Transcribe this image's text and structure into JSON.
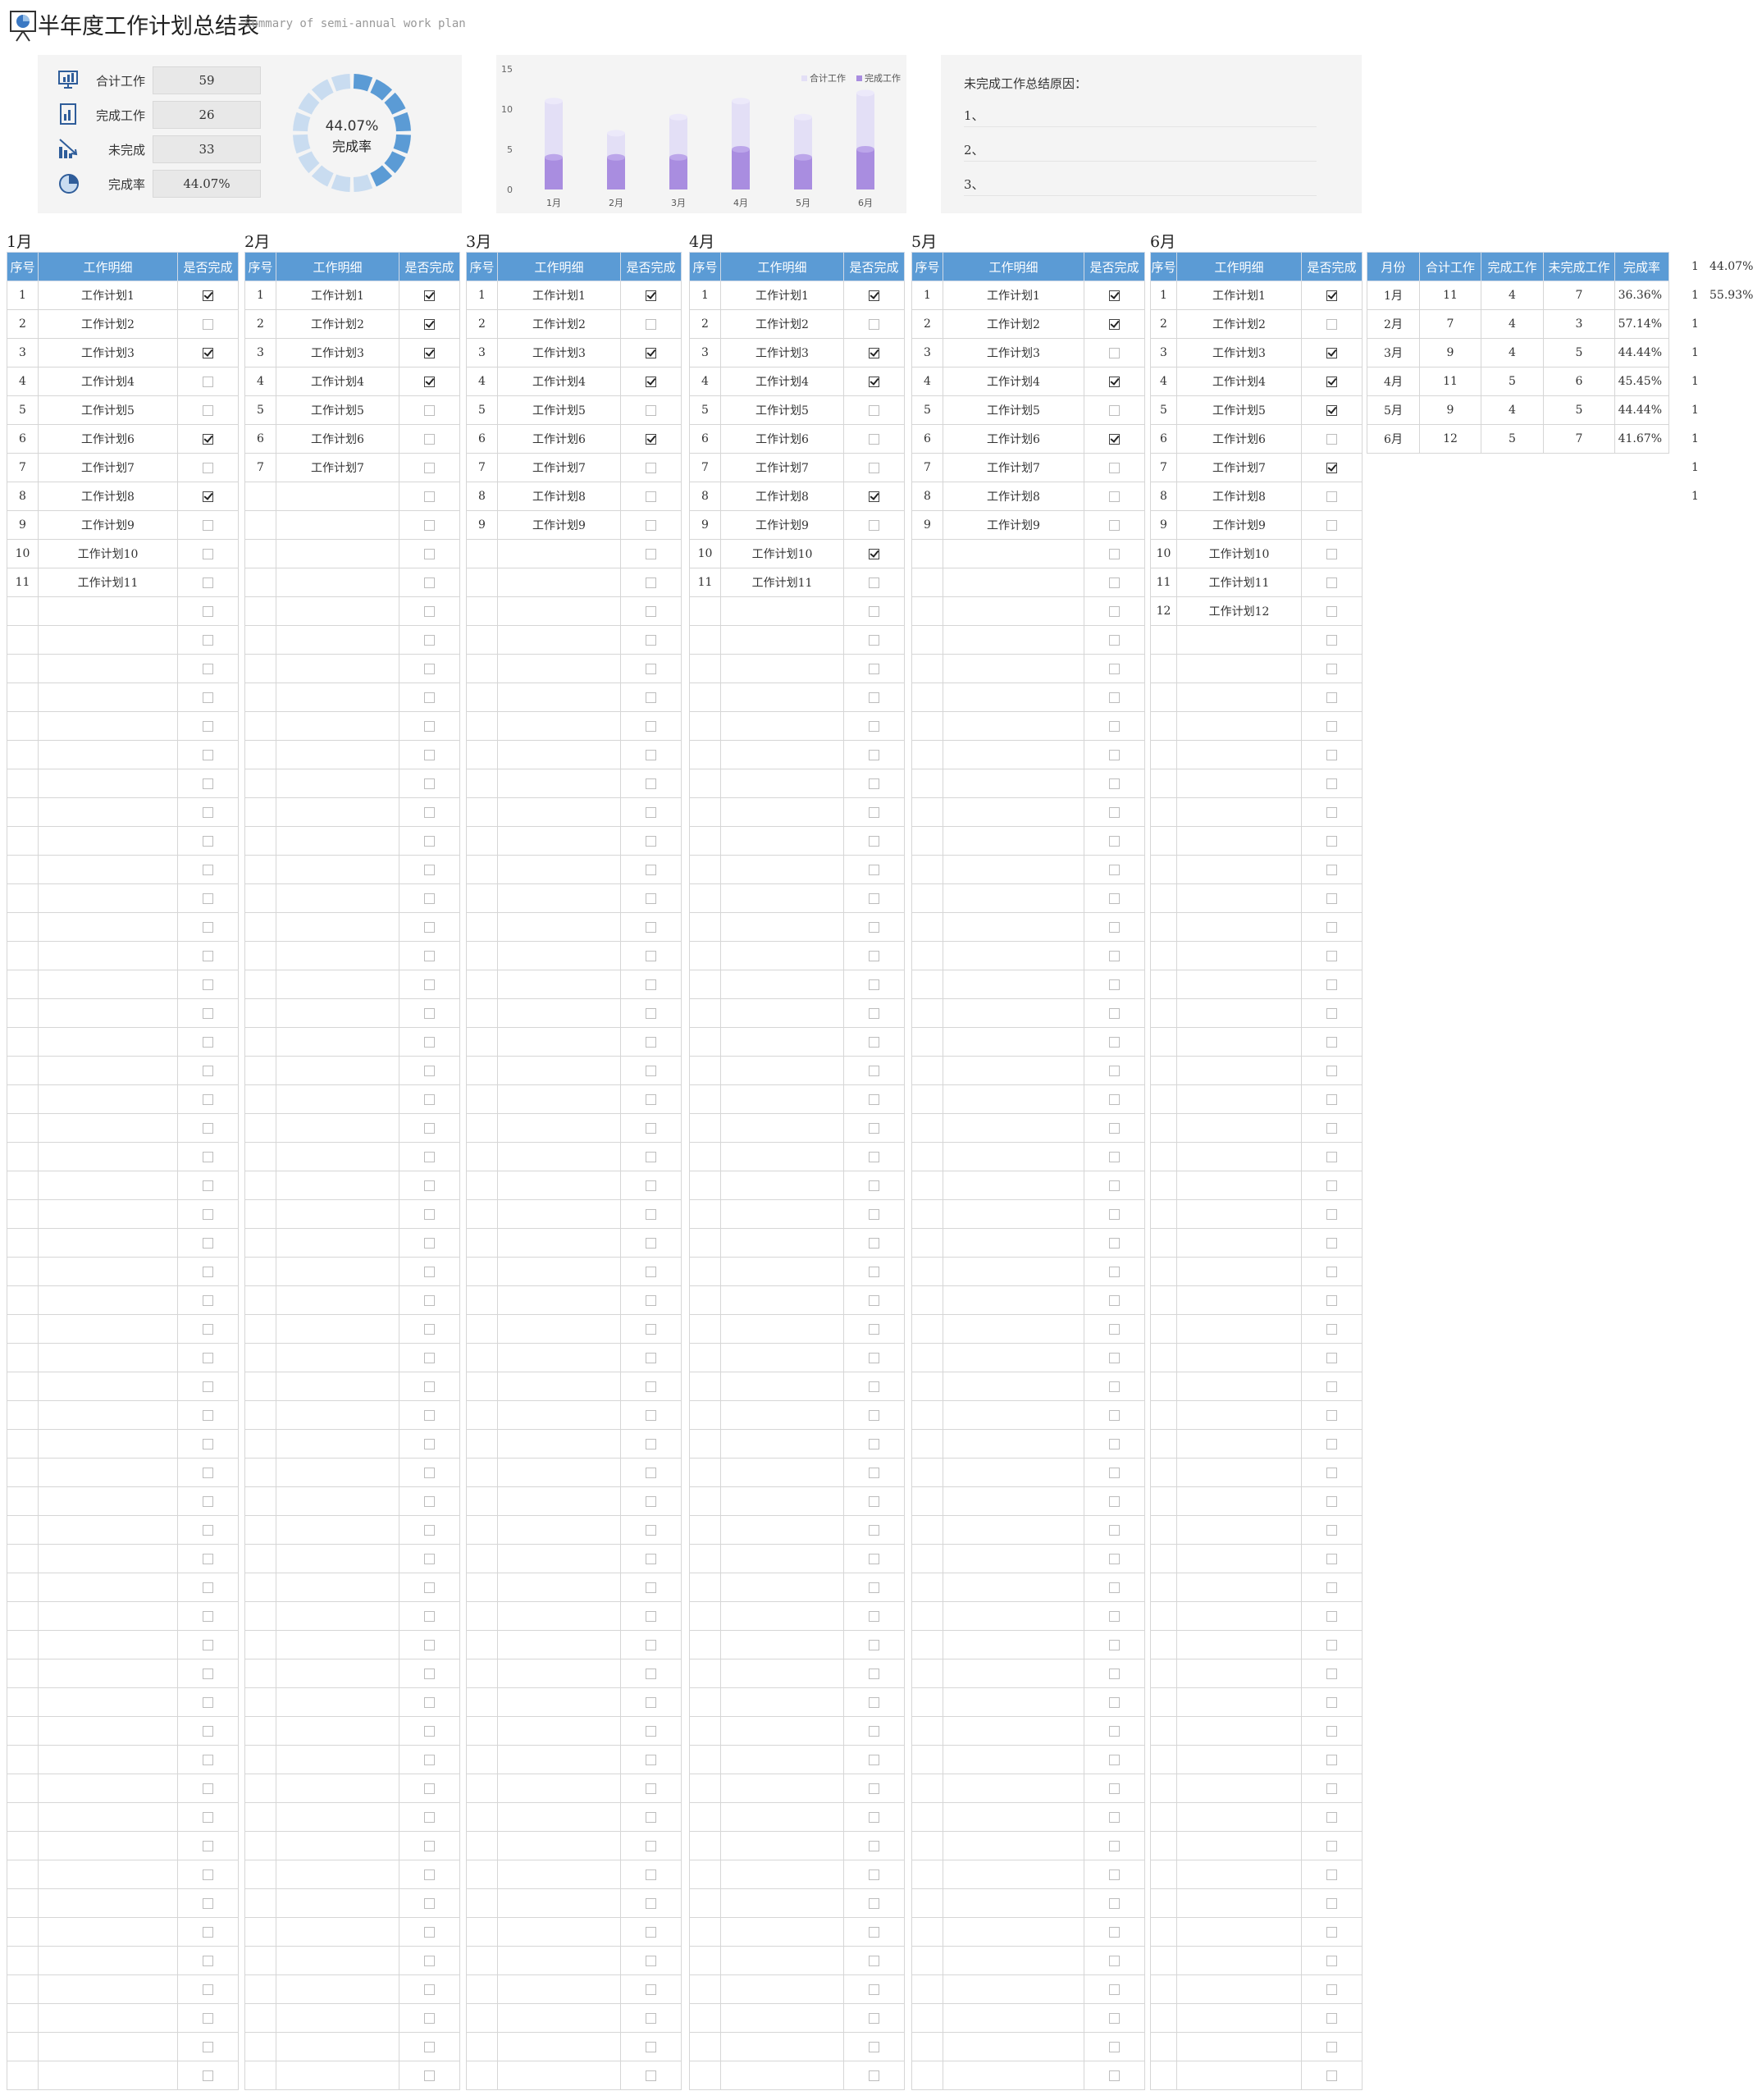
{
  "header": {
    "title": "半年度工作计划总结表",
    "subtitle": "Summary of semi-annual work plan"
  },
  "kpi": {
    "items": [
      {
        "label": "合计工作",
        "value": "59",
        "icon": "monitor-chart-icon"
      },
      {
        "label": "完成工作",
        "value": "26",
        "icon": "document-chart-icon"
      },
      {
        "label": "未完成",
        "value": "33",
        "icon": "trend-down-chart-icon"
      },
      {
        "label": "完成率",
        "value": "44.07%",
        "icon": "pie-chart-icon"
      }
    ],
    "donut": {
      "percent_text": "44.07%",
      "label": "完成率",
      "fraction": 0.4407,
      "color_done": "#5b9bd5",
      "color_rest": "#c9dcf0"
    }
  },
  "chart_data": {
    "type": "bar",
    "categories": [
      "1月",
      "2月",
      "3月",
      "4月",
      "5月",
      "6月"
    ],
    "series": [
      {
        "name": "合计工作",
        "values": [
          11,
          7,
          9,
          11,
          9,
          12
        ],
        "color": "#e3dff6"
      },
      {
        "name": "完成工作",
        "values": [
          4,
          4,
          4,
          5,
          4,
          5
        ],
        "color": "#a98de0"
      }
    ],
    "ylim": [
      0,
      15
    ],
    "yticks": [
      "0",
      "5",
      "10",
      "15"
    ],
    "legend": "top-right",
    "legend_labels": [
      "合计工作",
      "完成工作"
    ]
  },
  "notes": {
    "title": "未完成工作总结原因：",
    "lines": [
      "1、",
      "2、",
      "3、"
    ]
  },
  "table_headers": {
    "no": "序号",
    "detail": "工作明细",
    "done": "是否完成"
  },
  "months": [
    {
      "label": "1月",
      "items": [
        "工作计划1",
        "工作计划2",
        "工作计划3",
        "工作计划4",
        "工作计划5",
        "工作计划6",
        "工作计划7",
        "工作计划8",
        "工作计划9",
        "工作计划10",
        "工作计划11"
      ],
      "done": [
        1,
        0,
        1,
        0,
        0,
        1,
        0,
        1,
        0,
        0,
        0
      ]
    },
    {
      "label": "2月",
      "items": [
        "工作计划1",
        "工作计划2",
        "工作计划3",
        "工作计划4",
        "工作计划5",
        "工作计划6",
        "工作计划7"
      ],
      "done": [
        1,
        1,
        1,
        1,
        0,
        0,
        0
      ]
    },
    {
      "label": "3月",
      "items": [
        "工作计划1",
        "工作计划2",
        "工作计划3",
        "工作计划4",
        "工作计划5",
        "工作计划6",
        "工作计划7",
        "工作计划8",
        "工作计划9"
      ],
      "done": [
        1,
        0,
        1,
        1,
        0,
        1,
        0,
        0,
        0
      ]
    },
    {
      "label": "4月",
      "items": [
        "工作计划1",
        "工作计划2",
        "工作计划3",
        "工作计划4",
        "工作计划5",
        "工作计划6",
        "工作计划7",
        "工作计划8",
        "工作计划9",
        "工作计划10",
        "工作计划11"
      ],
      "done": [
        1,
        0,
        1,
        1,
        0,
        0,
        0,
        1,
        0,
        1,
        0
      ]
    },
    {
      "label": "5月",
      "items": [
        "工作计划1",
        "工作计划2",
        "工作计划3",
        "工作计划4",
        "工作计划5",
        "工作计划6",
        "工作计划7",
        "工作计划8",
        "工作计划9"
      ],
      "done": [
        1,
        1,
        0,
        1,
        0,
        1,
        0,
        0,
        0
      ]
    },
    {
      "label": "6月",
      "items": [
        "工作计划1",
        "工作计划2",
        "工作计划3",
        "工作计划4",
        "工作计划5",
        "工作计划6",
        "工作计划7",
        "工作计划8",
        "工作计划9",
        "工作计划10",
        "工作计划11",
        "工作计划12"
      ],
      "done": [
        1,
        0,
        1,
        1,
        1,
        0,
        1,
        0,
        0,
        0,
        0,
        0
      ]
    }
  ],
  "summary": {
    "headers": [
      "月份",
      "合计工作",
      "完成工作",
      "未完成工作",
      "完成率"
    ],
    "rows": [
      [
        "1月",
        "11",
        "4",
        "7",
        "36.36%"
      ],
      [
        "2月",
        "7",
        "4",
        "3",
        "57.14%"
      ],
      [
        "3月",
        "9",
        "4",
        "5",
        "44.44%"
      ],
      [
        "4月",
        "11",
        "5",
        "6",
        "45.45%"
      ],
      [
        "5月",
        "9",
        "4",
        "5",
        "44.44%"
      ],
      [
        "6月",
        "12",
        "5",
        "7",
        "41.67%"
      ]
    ]
  },
  "side_values": [
    {
      "n": "1",
      "pct": "44.07%"
    },
    {
      "n": "1",
      "pct": "55.93%"
    },
    {
      "n": "1",
      "pct": ""
    },
    {
      "n": "1",
      "pct": ""
    },
    {
      "n": "1",
      "pct": ""
    },
    {
      "n": "1",
      "pct": ""
    },
    {
      "n": "1",
      "pct": ""
    },
    {
      "n": "1",
      "pct": ""
    },
    {
      "n": "1",
      "pct": ""
    }
  ]
}
